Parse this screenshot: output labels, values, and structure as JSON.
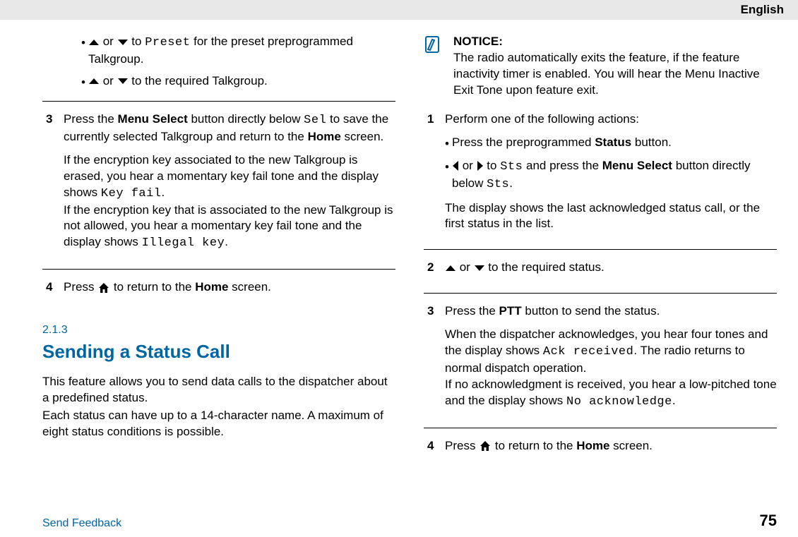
{
  "header": {
    "lang": "English"
  },
  "left": {
    "b1_pre": " or ",
    "b1_mid": " to ",
    "b1_code": "Preset",
    "b1_post": " for the preset preprogrammed Talkgroup.",
    "b2_pre": " or ",
    "b2_post": " to the required Talkgroup.",
    "s3_num": "3",
    "s3_p1a": "Press the ",
    "s3_p1b": "Menu Select",
    "s3_p1c": " button directly below ",
    "s3_code1": "Sel",
    "s3_p1d": " to save the currently selected Talkgroup and return to the ",
    "s3_p1e": "Home",
    "s3_p1f": " screen.",
    "s3_p2a": "If the encryption key associated to the new Talkgroup is erased, you hear a momentary key fail tone and the display shows ",
    "s3_code2": "Key fail",
    "s3_p2b": ".",
    "s3_p3a": "If the encryption key that is associated to the new Talkgroup is not allowed, you hear a momentary key fail tone and the display shows ",
    "s3_code3": "Illegal key",
    "s3_p3b": ".",
    "s4_num": "4",
    "s4_a": "Press ",
    "s4_b": " to return to the ",
    "s4_c": "Home",
    "s4_d": " screen.",
    "secnum": "2.1.3",
    "sechead": "Sending a Status Call",
    "secp1": "This feature allows you to send data calls to the dispatcher about a predefined status.",
    "secp2": "Each status can have up to a 14-character name. A maximum of eight status conditions is possible."
  },
  "right": {
    "notice_h": "NOTICE:",
    "notice_b": "The radio automatically exits the feature, if the feature inactivity timer is enabled. You will hear the Menu Inactive Exit Tone upon feature exit.",
    "s1_num": "1",
    "s1_lead": "Perform one of the following actions:",
    "s1_b1a": "Press the preprogrammed ",
    "s1_b1b": "Status",
    "s1_b1c": " button.",
    "s1_b2a": " or ",
    "s1_b2b": " to ",
    "s1_b2code1": "Sts",
    "s1_b2c": " and press the ",
    "s1_b2d": "Menu Select",
    "s1_b2e": " button directly below ",
    "s1_b2code2": "Sts",
    "s1_b2f": ".",
    "s1_tail": "The display shows the last acknowledged status call, or the first status in the list.",
    "s2_num": "2",
    "s2_a": " or ",
    "s2_b": " to the required status.",
    "s3_num": "3",
    "s3_a": "Press the ",
    "s3_b": "PTT",
    "s3_c": " button to send the status.",
    "s3_p2a": "When the dispatcher acknowledges, you hear four tones and the display shows ",
    "s3_code1": "Ack received",
    "s3_p2b": ". The radio returns to normal dispatch operation.",
    "s3_p3a": "If no acknowledgment is received, you hear a low-pitched tone and the display shows ",
    "s3_code2": "No acknowledge",
    "s3_p3b": ".",
    "s4_num": "4",
    "s4_a": "Press ",
    "s4_b": " to return to the ",
    "s4_c": "Home",
    "s4_d": " screen."
  },
  "footer": {
    "feedback": "Send Feedback",
    "page": "75"
  }
}
